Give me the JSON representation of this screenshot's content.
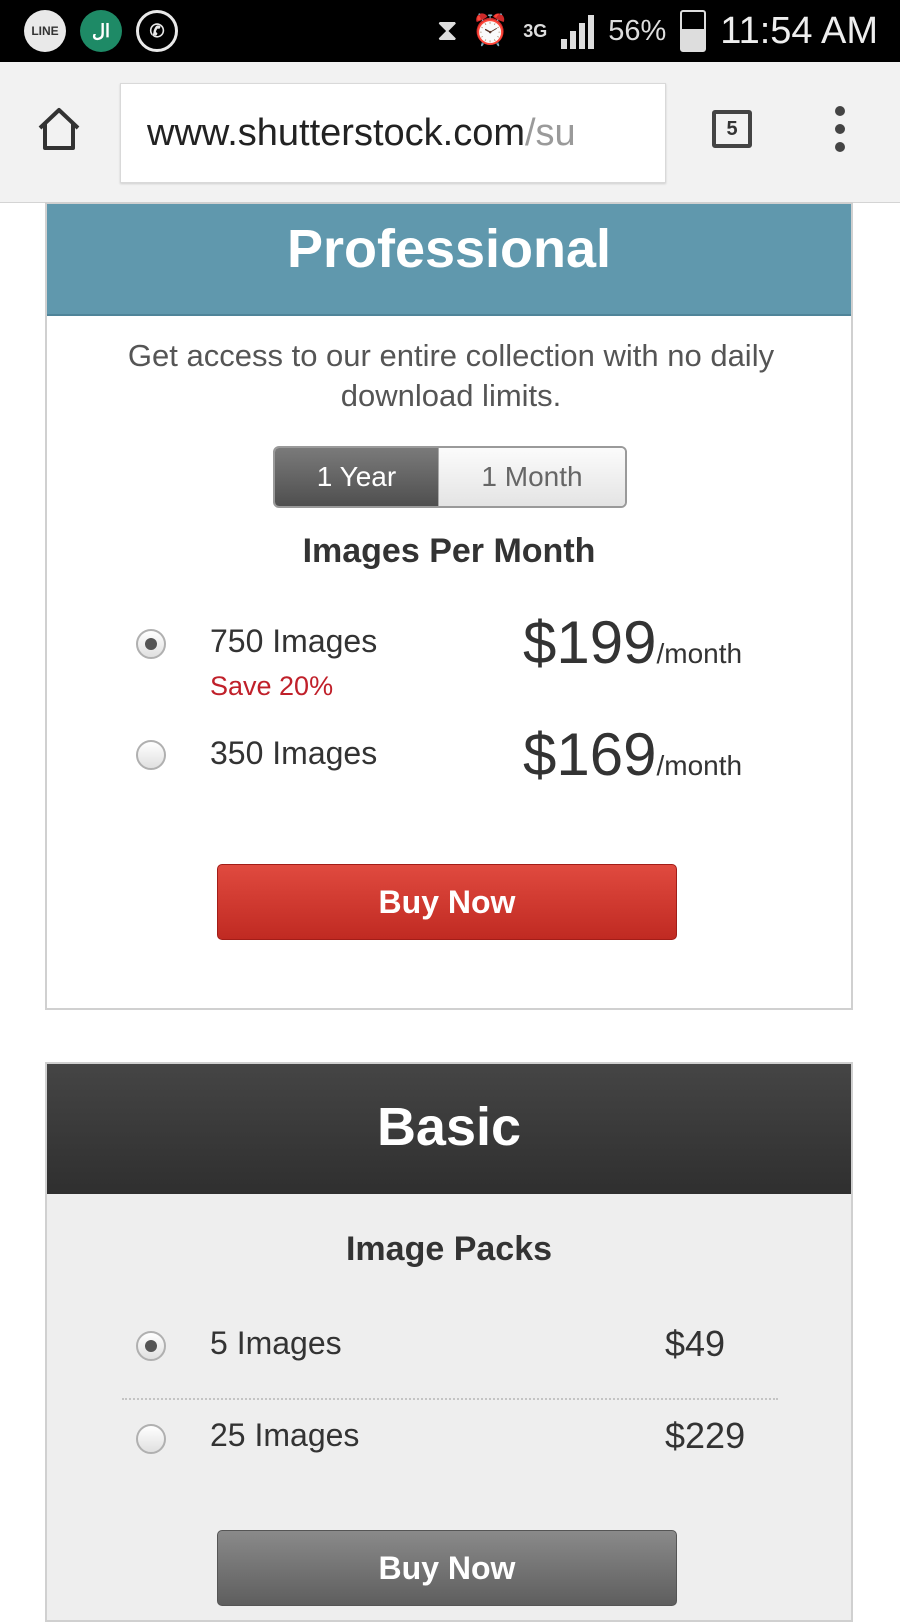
{
  "status_bar": {
    "apps": [
      "LINE",
      "ال",
      "whatsapp"
    ],
    "network": "3G",
    "battery_percent": "56%",
    "time": "11:54 AM"
  },
  "browser": {
    "url_host": "www.shutterstock.com",
    "url_path": "/su",
    "tab_count": "5"
  },
  "professional": {
    "title": "Professional",
    "description": "Get access to our entire collection with no daily download limits.",
    "toggle": {
      "selected": "1 Year",
      "other": "1 Month"
    },
    "section_heading": "Images Per Month",
    "options": [
      {
        "label": "750 Images",
        "note": "Save 20%",
        "price": "$199",
        "period": "/month",
        "selected": true
      },
      {
        "label": "350 Images",
        "note": "",
        "price": "$169",
        "period": "/month",
        "selected": false
      }
    ],
    "buy_label": "Buy Now"
  },
  "basic": {
    "title": "Basic",
    "section_heading": "Image Packs",
    "packs": [
      {
        "label": "5 Images",
        "price": "$49",
        "selected": true
      },
      {
        "label": "25 Images",
        "price": "$229",
        "selected": false
      }
    ],
    "buy_label": "Buy Now"
  }
}
